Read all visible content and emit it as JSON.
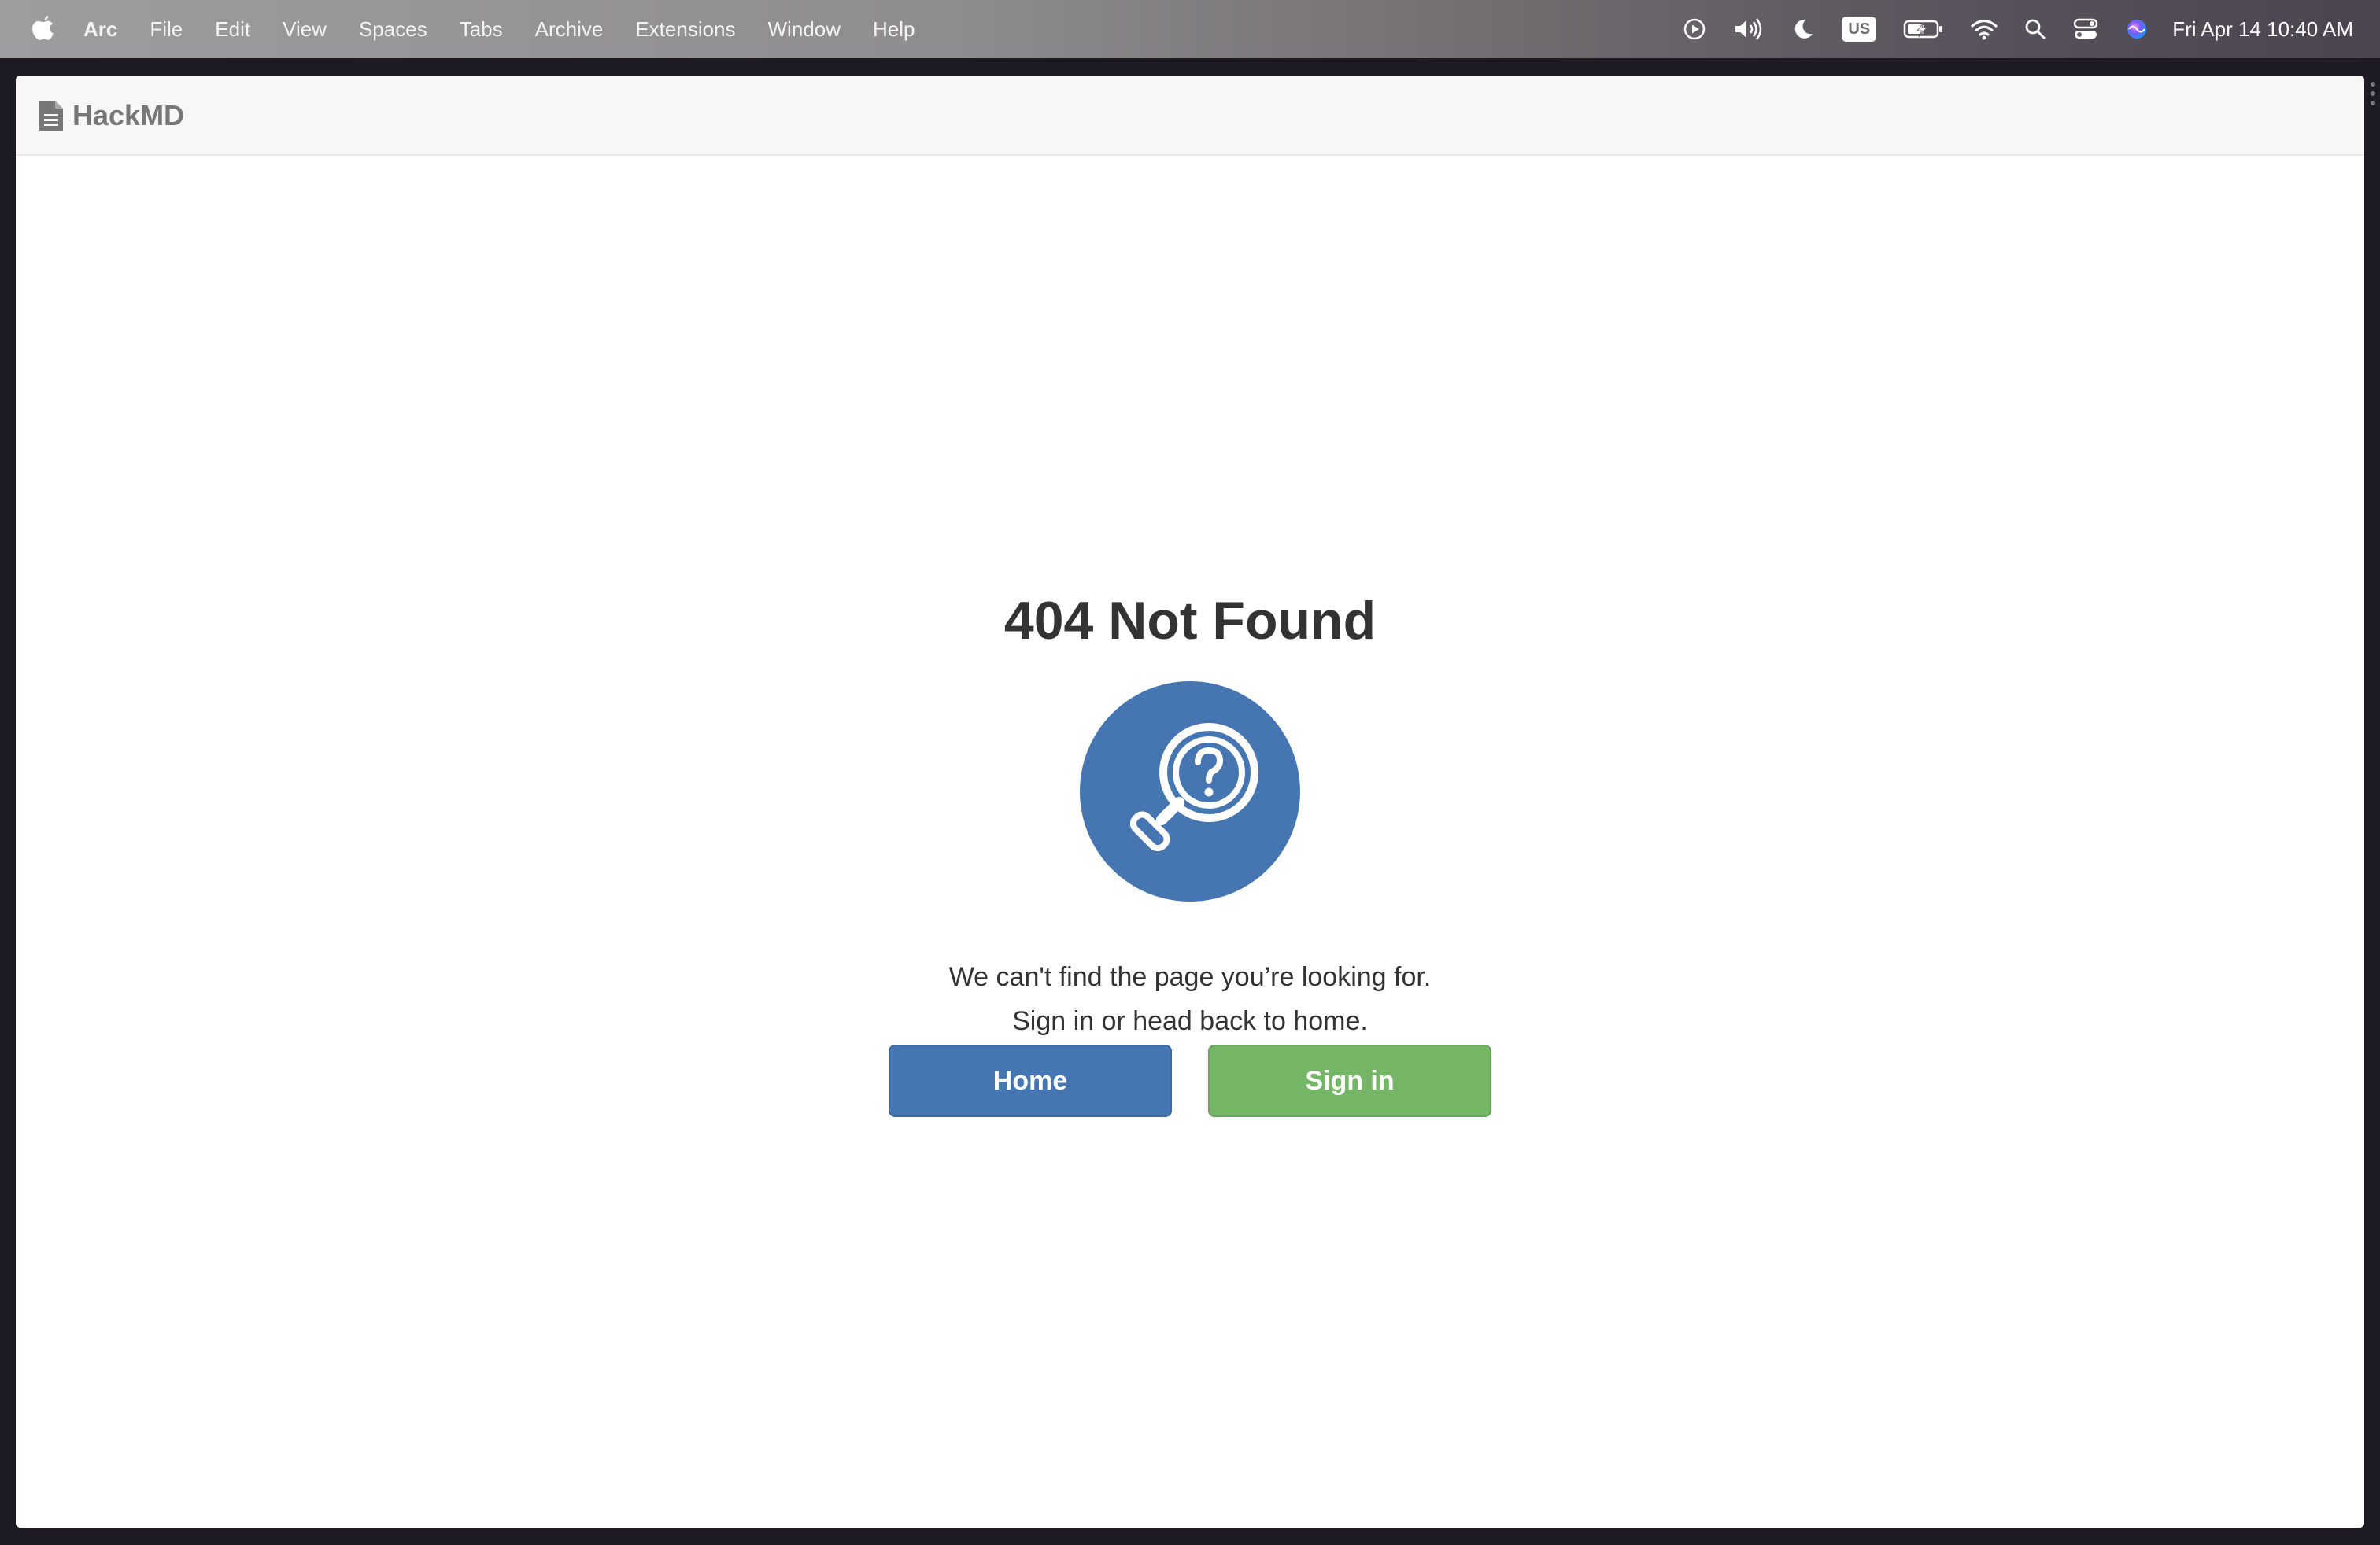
{
  "menubar": {
    "app_name": "Arc",
    "items": [
      "File",
      "Edit",
      "View",
      "Spaces",
      "Tabs",
      "Archive",
      "Extensions",
      "Window",
      "Help"
    ],
    "keyboard_layout": "US",
    "clock": "Fri Apr 14  10:40 AM",
    "status_icons": [
      "play-circle-icon",
      "volume-icon",
      "moon-icon",
      "keyboard-layout-badge",
      "battery-charging-icon",
      "wifi-icon",
      "search-icon",
      "control-center-icon",
      "siri-icon"
    ]
  },
  "site": {
    "brand": "HackMD",
    "brand_icon": "document-icon"
  },
  "error_page": {
    "title": "404 Not Found",
    "illustration_icon": "magnifier-question-icon",
    "message_line1": "We can't find the page you’re looking for.",
    "message_line2": "Sign in or head back to home.",
    "home_label": "Home",
    "signin_label": "Sign in"
  },
  "colors": {
    "primary": "#4576b1",
    "success": "#74b566",
    "title_text": "#333333",
    "brand_text": "#777777"
  }
}
